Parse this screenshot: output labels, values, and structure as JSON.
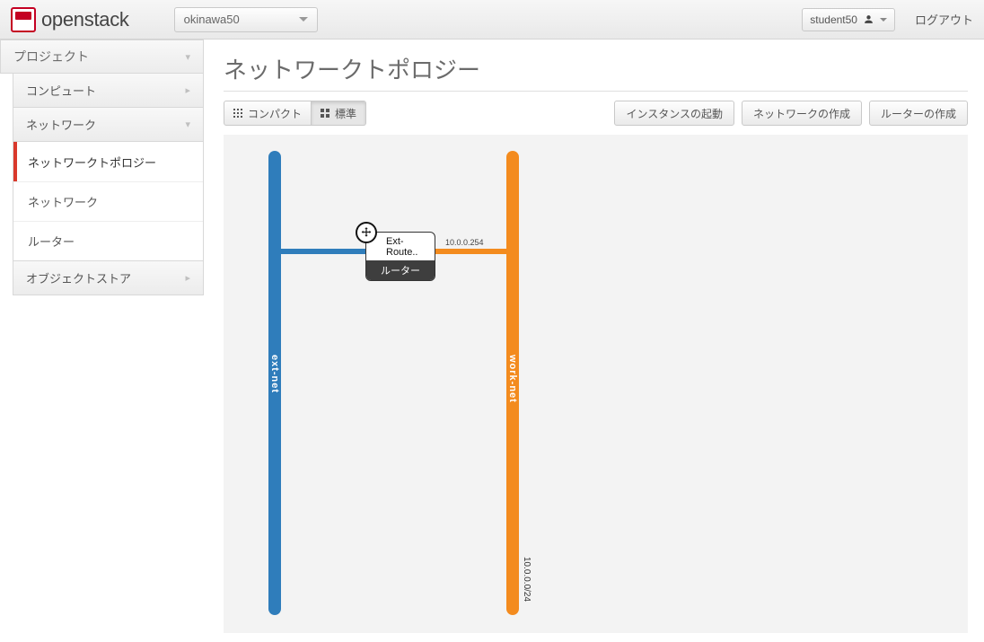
{
  "header": {
    "brand": "openstack",
    "project_selected": "okinawa50",
    "user": "student50",
    "logout": "ログアウト"
  },
  "sidebar": {
    "root_label": "プロジェクト",
    "groups": [
      {
        "label": "コンピュート",
        "expanded": false
      },
      {
        "label": "ネットワーク",
        "expanded": true,
        "items": [
          {
            "label": "ネットワークトポロジー",
            "active": true
          },
          {
            "label": "ネットワーク",
            "active": false
          },
          {
            "label": "ルーター",
            "active": false
          }
        ]
      },
      {
        "label": "オブジェクトストア",
        "expanded": false
      }
    ]
  },
  "page": {
    "title": "ネットワークトポロジー",
    "view_compact": "コンパクト",
    "view_normal": "標準",
    "launch_instance": "インスタンスの起動",
    "create_network": "ネットワークの作成",
    "create_router": "ルーターの作成"
  },
  "topology": {
    "networks": [
      {
        "name": "ext-net",
        "color": "#2f7dbb"
      },
      {
        "name": "work-net",
        "color": "#f38b1e",
        "cidr": "10.0.0.0/24"
      }
    ],
    "router": {
      "name_short": "Ext-Route..",
      "type_label": "ルーター",
      "interfaces": [
        {
          "network": "ext-net",
          "ip": null
        },
        {
          "network": "work-net",
          "ip": "10.0.0.254"
        }
      ]
    }
  }
}
